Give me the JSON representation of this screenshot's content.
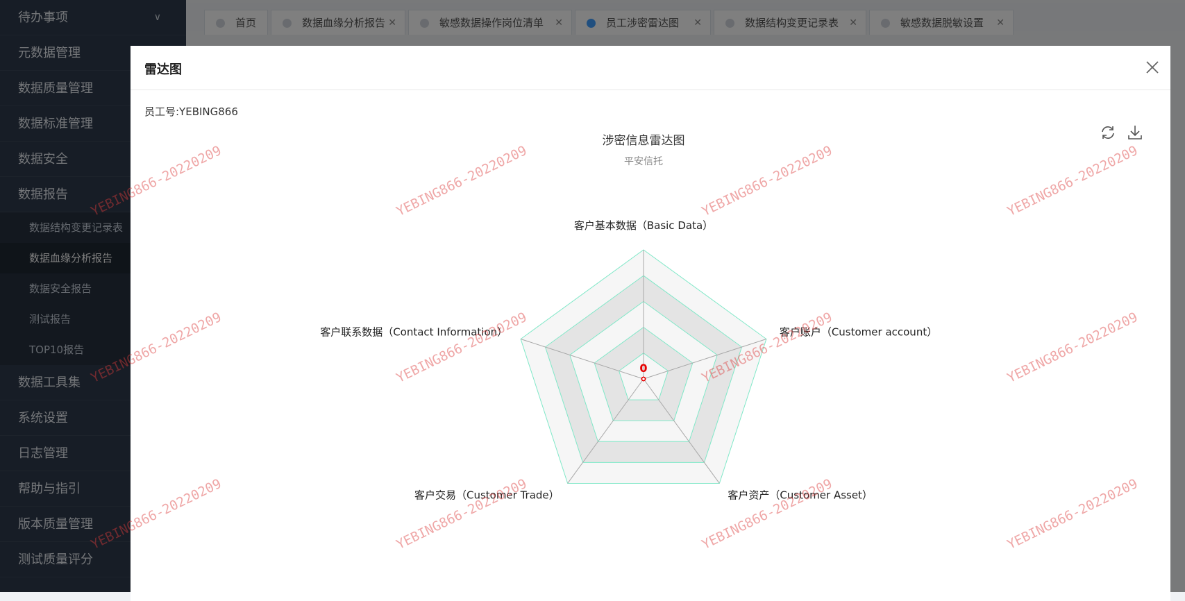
{
  "sidebar": {
    "items": [
      {
        "label": "待办事项"
      },
      {
        "label": "元数据管理"
      },
      {
        "label": "数据质量管理"
      },
      {
        "label": "数据标准管理"
      },
      {
        "label": "数据安全"
      },
      {
        "label": "数据报告"
      }
    ],
    "sub_items": [
      {
        "label": "数据结构变更记录表"
      },
      {
        "label": "数据血缘分析报告"
      },
      {
        "label": "数据安全报告"
      },
      {
        "label": "测试报告"
      },
      {
        "label": "TOP10报告"
      }
    ],
    "items_after": [
      {
        "label": "数据工具集"
      },
      {
        "label": "系统设置"
      },
      {
        "label": "日志管理"
      },
      {
        "label": "帮助与指引"
      },
      {
        "label": "版本质量管理"
      },
      {
        "label": "测试质量评分"
      }
    ]
  },
  "tabs": [
    {
      "label": "首页"
    },
    {
      "label": "数据血缘分析报告"
    },
    {
      "label": "敏感数据操作岗位清单"
    },
    {
      "label": "员工涉密雷达图"
    },
    {
      "label": "数据结构变更记录表"
    },
    {
      "label": "敏感数据脱敏设置"
    }
  ],
  "modal": {
    "title": "雷达图",
    "employee_label": "员工号:YEBING866"
  },
  "watermark": "YEBING866-20220209",
  "colors": {
    "accent": "#409eff",
    "radar_line": "#80e8c8",
    "value": "#e60000"
  },
  "chart_data": {
    "type": "radar",
    "title": "涉密信息雷达图",
    "subtitle": "平安信托",
    "indicators": [
      "客户基本数据（Basic Data）",
      "客户账户（Customer account）",
      "客户资产（Customer Asset）",
      "客户交易（Customer Trade）",
      "客户联系数据（Contact Information）"
    ],
    "values": [
      0,
      0,
      0,
      0,
      0
    ],
    "split_number": 5,
    "value_label": "0"
  }
}
